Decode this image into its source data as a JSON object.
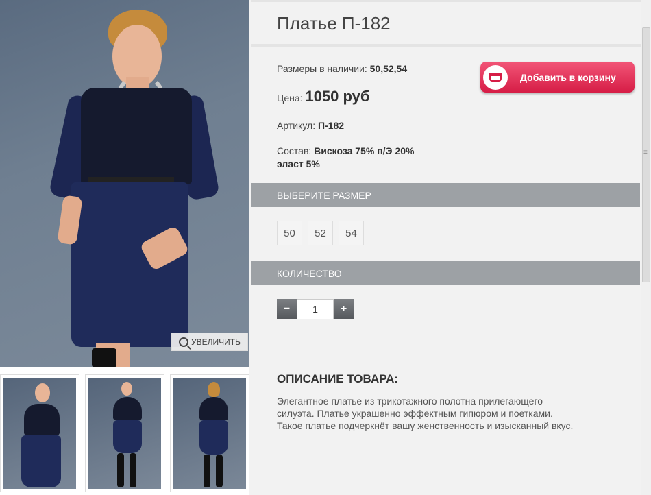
{
  "product": {
    "title": "Платье П-182",
    "sizes_label": "Размеры в наличии:",
    "sizes_value": "50,52,54",
    "price_label": "Цена:",
    "price_value": "1050 руб",
    "article_label": "Артикул:",
    "article_value": "П-182",
    "composition_label": "Состав:",
    "composition_value_1": "Вискоза 75% п/Э 20%",
    "composition_value_2": "эласт 5%"
  },
  "cart": {
    "add_label": "Добавить в корзину"
  },
  "gallery": {
    "zoom_label": "УВЕЛИЧИТЬ"
  },
  "size_section": {
    "title": "ВЫБЕРИТЕ РАЗМЕР",
    "options": [
      "50",
      "52",
      "54"
    ]
  },
  "quantity_section": {
    "title": "КОЛИЧЕСТВО",
    "minus": "−",
    "plus": "+",
    "value": "1"
  },
  "description": {
    "title": "ОПИСАНИЕ ТОВАРА:",
    "line1": "Элегантное платье из трикотажного полотна прилегающего",
    "line2": "силуэта.  Платье украшенно эффектным гипюром и поетками.",
    "line3": "Такое платье подчеркнёт вашу женственность и изысканный вкус."
  },
  "colors": {
    "accent": "#d61d46",
    "section_bar": "#9da1a5",
    "dress": "#1f2b5a"
  },
  "icons": {
    "zoom": "magnifier-plus-icon",
    "basket": "basket-icon"
  }
}
